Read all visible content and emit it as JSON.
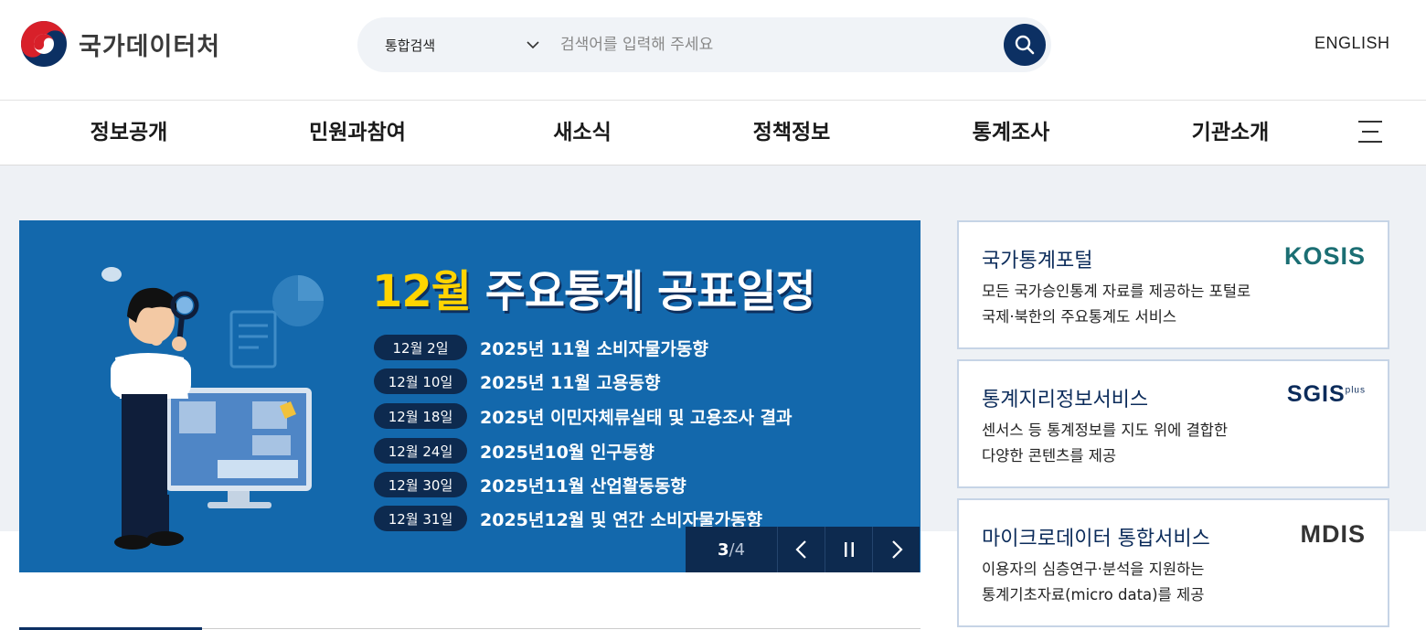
{
  "header": {
    "logo_text": "국가데이터처",
    "search": {
      "scope_label": "통합검색",
      "placeholder": "검색어를 입력해 주세요"
    },
    "english_label": "ENGLISH"
  },
  "nav": {
    "items": [
      "정보공개",
      "민원과참여",
      "새소식",
      "정책정보",
      "통계조사",
      "기관소개"
    ]
  },
  "banner": {
    "title_month": "12월",
    "title_rest": "주요통계 공표일정",
    "schedule": [
      {
        "date": "12월  2일",
        "text": "2025년 11월 소비자물가동향"
      },
      {
        "date": "12월 10일",
        "text": "2025년 11월 고용동향"
      },
      {
        "date": "12월 18일",
        "text": "2025년 이민자체류실태 및 고용조사 결과"
      },
      {
        "date": "12월 24일",
        "text": "2025년10월 인구동향"
      },
      {
        "date": "12월 30일",
        "text": "2025년11월 산업활동동향"
      },
      {
        "date": "12월 31일",
        "text": "2025년12월 및 연간 소비자물가동향"
      }
    ],
    "pager": {
      "current": "3",
      "separator": "/",
      "total": "4"
    }
  },
  "cards": [
    {
      "title": "국가통계포털",
      "desc": "모든 국가승인통계 자료를 제공하는 포털로\n국제·북한의 주요통계도 서비스",
      "brand": "KOSIS",
      "brand_color": "#1b6e73"
    },
    {
      "title": "통계지리정보서비스",
      "desc": "센서스 등 통계정보를 지도 위에 결합한\n다양한 콘텐츠를 제공",
      "brand": "SGIS",
      "brand_sup": "plus",
      "brand_color": "#0c2c5b"
    },
    {
      "title": "마이크로데이터 통합서비스",
      "desc": "이용자의 심층연구·분석을 지원하는\n통계기초자료(micro data)를 제공",
      "brand": "MDIS",
      "brand_color": "#333333"
    }
  ],
  "colors": {
    "primary": "#0c3063",
    "banner_bg": "#1368ac",
    "accent_yellow": "#ffd400"
  }
}
